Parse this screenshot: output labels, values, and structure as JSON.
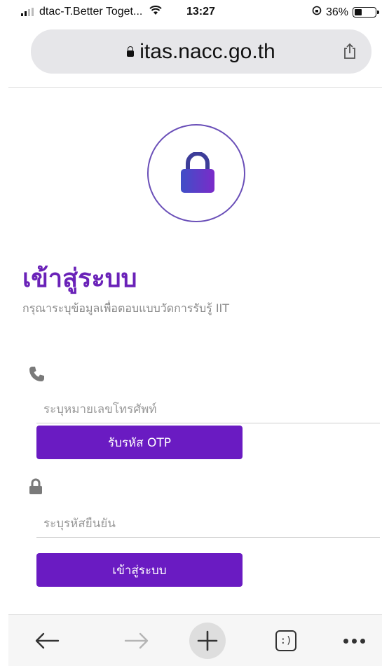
{
  "status_bar": {
    "carrier": "dtac-T.Better Toget...",
    "time": "13:27",
    "battery": "36%",
    "battery_level": 0.36
  },
  "browser": {
    "url": "itas.nacc.go.th"
  },
  "login": {
    "title": "เข้าสู่ระบบ",
    "subtitle": "กรุณาระบุข้อมูลเพื่อตอบแบบวัดการรับรู้ IIT",
    "phone_placeholder": "ระบุหมายเลขโทรศัพท์",
    "otp_button": "รับรหัส OTP",
    "code_placeholder": "ระบุรหัสยืนยัน",
    "login_button": "เข้าสู่ระบบ"
  },
  "toolbar": {
    "tabs_label": ":)"
  },
  "colors": {
    "accent": "#6a1bc2",
    "title": "#6a22b8"
  }
}
